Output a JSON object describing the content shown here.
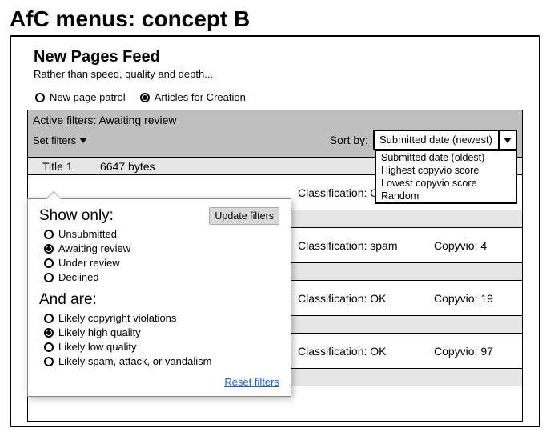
{
  "concept_title": "AfC menus: concept B",
  "feed": {
    "title": "New Pages Feed",
    "subtitle": "Rather than speed, quality and depth..."
  },
  "mode": {
    "options": [
      {
        "label": "New page patrol",
        "checked": false
      },
      {
        "label": "Articles for Creation",
        "checked": true
      }
    ]
  },
  "filters_bar": {
    "active_label": "Active filters:",
    "active_value": "Awaiting review",
    "set_filters_label": "Set filters",
    "sort_label": "Sort by:",
    "sort_selected": "Submitted date (newest)",
    "sort_options": [
      "Submitted date (oldest)",
      "Highest copyvio score",
      "Lowest copyvio score",
      "Random"
    ]
  },
  "rows": [
    {
      "title": "Title 1",
      "bytes": "6647 bytes",
      "classification": "Classification: O",
      "copyvio": ""
    },
    {
      "title": "",
      "bytes": "",
      "classification": "Classification: spam",
      "copyvio": "Copyvio: 4"
    },
    {
      "title": "",
      "bytes": "",
      "classification": "Classification: OK",
      "copyvio": "Copyvio: 19"
    },
    {
      "title": "",
      "bytes": "",
      "classification": "Classification: OK",
      "copyvio": "Copyvio: 97"
    },
    {
      "title": "",
      "bytes": "",
      "classification": "",
      "copyvio": ""
    }
  ],
  "popup": {
    "show_only_title": "Show only:",
    "update_label": "Update filters",
    "status_options": [
      {
        "label": "Unsubmitted",
        "checked": false
      },
      {
        "label": "Awaiting review",
        "checked": true
      },
      {
        "label": "Under review",
        "checked": false
      },
      {
        "label": "Declined",
        "checked": false
      }
    ],
    "and_title": "And are:",
    "and_options": [
      {
        "label": "Likely copyright violations",
        "checked": false
      },
      {
        "label": "Likely high quality",
        "checked": true
      },
      {
        "label": "Likely low quality",
        "checked": false
      },
      {
        "label": "Likely spam, attack, or vandalism",
        "checked": false
      }
    ],
    "reset_label": "Reset filters"
  }
}
